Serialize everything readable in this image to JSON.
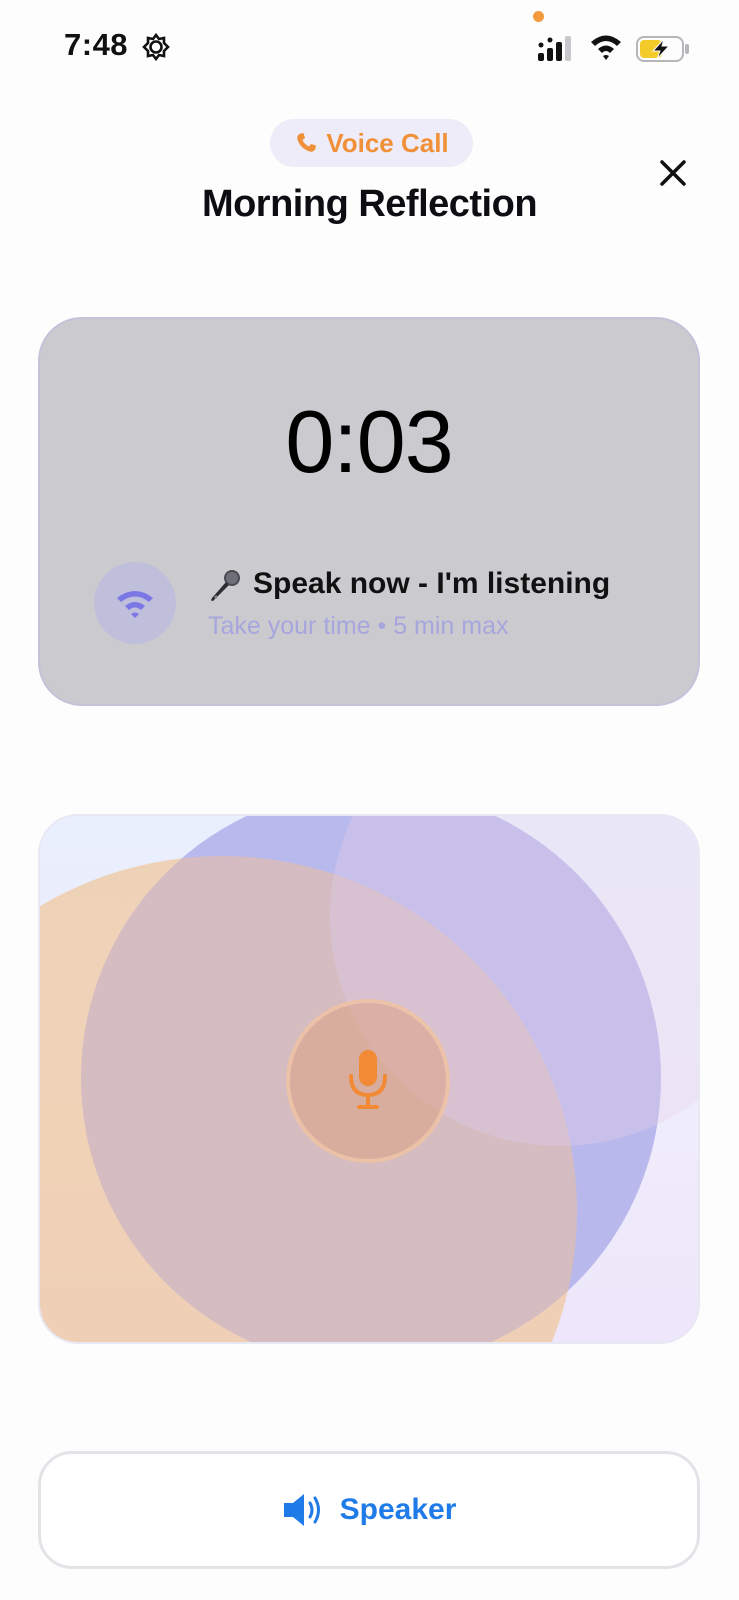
{
  "status_bar": {
    "time": "7:48",
    "icons": [
      "gear-icon",
      "cellular-signal-icon",
      "wifi-icon",
      "battery-charging-icon"
    ],
    "privacy_dot_color": "#f39a3c"
  },
  "header": {
    "pill_label": "Voice Call",
    "pill_icon": "phone-icon",
    "title": "Morning Reflection",
    "close_icon": "close-icon"
  },
  "timer_card": {
    "timer": "0:03",
    "status_icon": "wifi-broadcast-icon",
    "emoji": "🎤",
    "message": "Speak now - I'm listening",
    "hint": "Take your time • 5 min max"
  },
  "visualizer": {
    "mic_icon": "microphone-icon",
    "colors": {
      "blue": "#9fb3f7",
      "orange": "#f0c89c",
      "lavender": "#c3bdf0"
    }
  },
  "speaker": {
    "label": "Speaker",
    "icon": "speaker-icon"
  },
  "colors": {
    "accent_orange": "#f0913a",
    "accent_blue": "#1f7be8",
    "accent_purple": "#7b78e6"
  }
}
